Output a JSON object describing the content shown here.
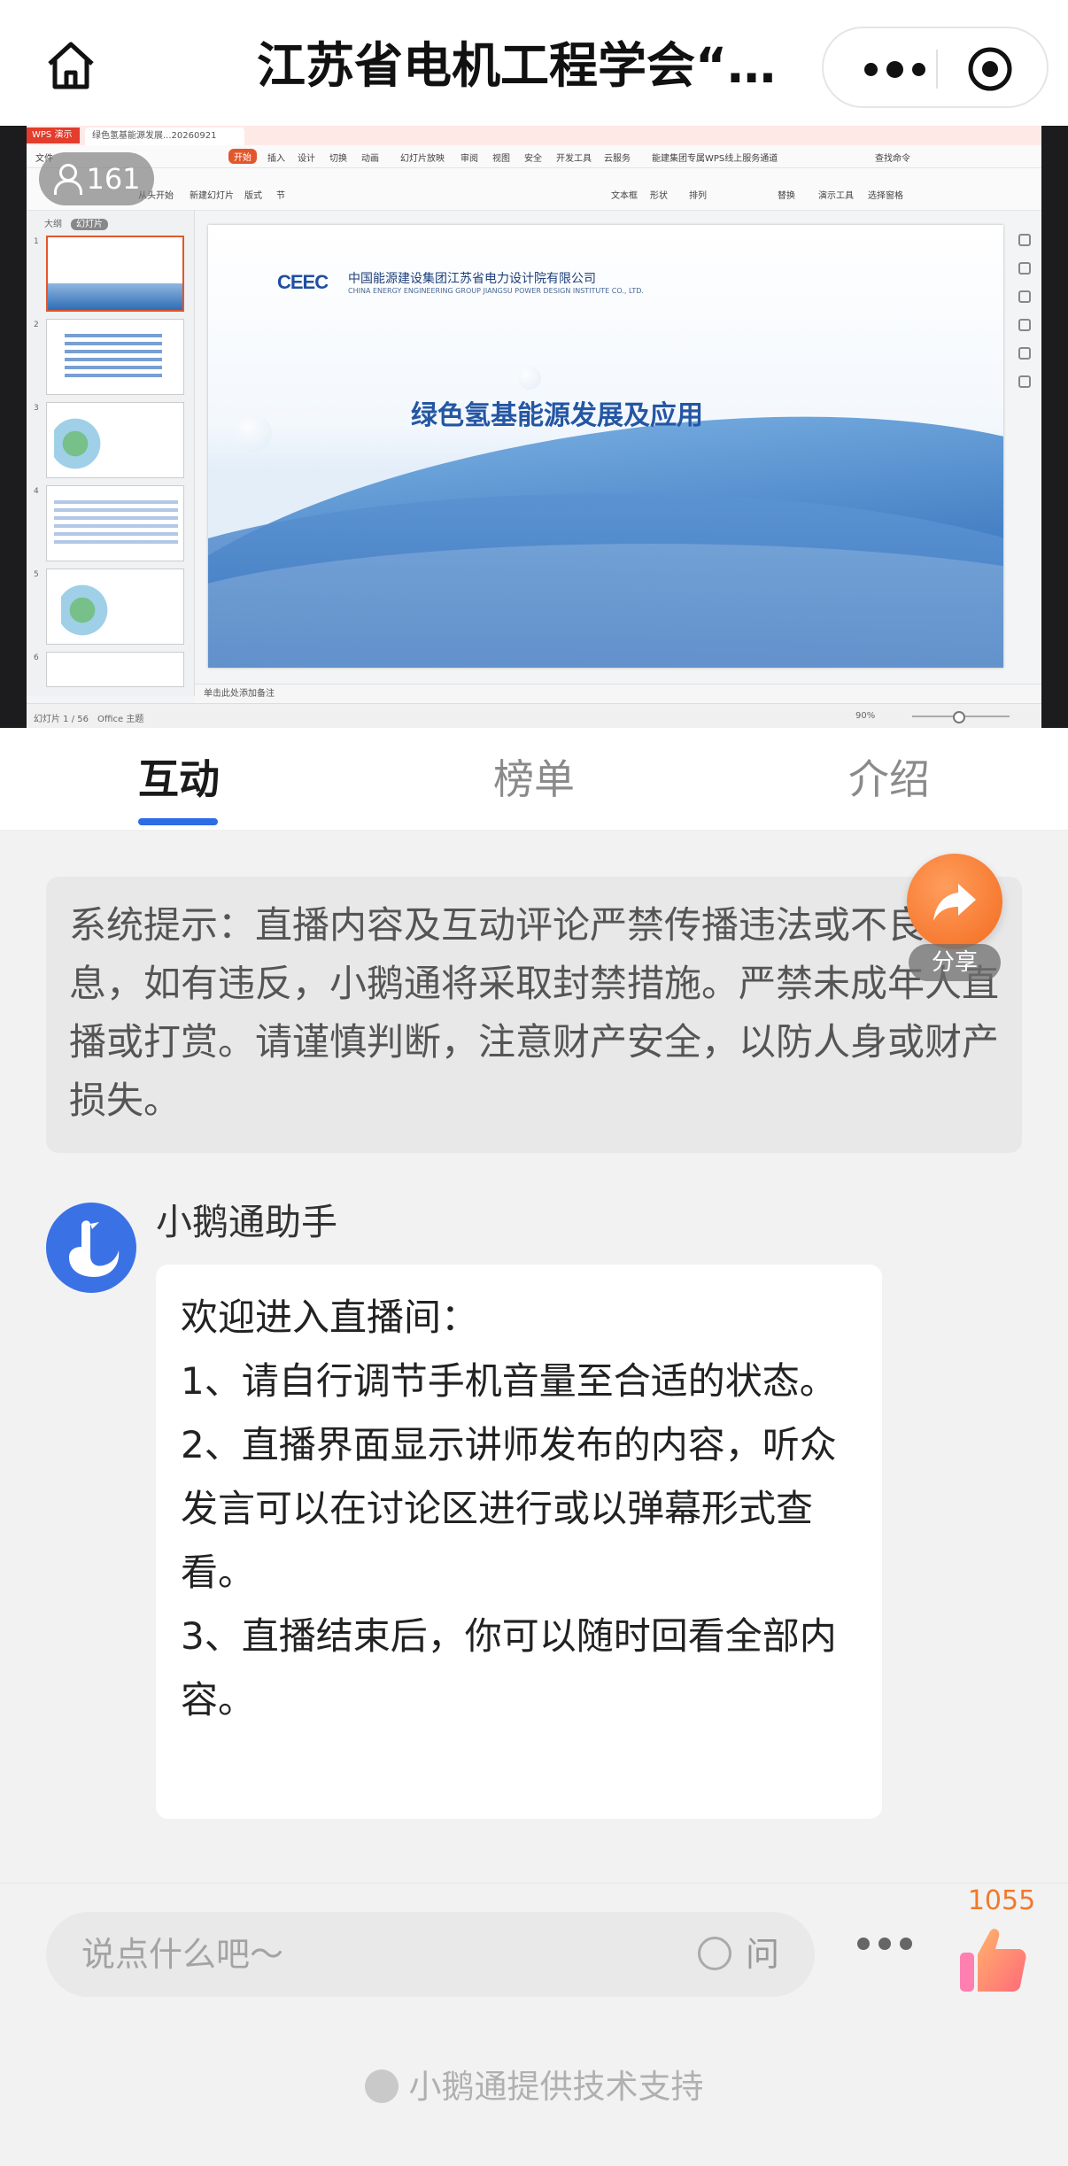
{
  "nav": {
    "title": "江苏省电机工程学会“…"
  },
  "stream": {
    "viewer_count": "161",
    "app_tab1": "WPS 演示",
    "app_tab2": "绿色氢基能源发展...20260921",
    "menu": [
      "文件",
      "开始",
      "插入",
      "设计",
      "切换",
      "动画",
      "幻灯片放映",
      "审阅",
      "视图",
      "安全",
      "开发工具",
      "云服务",
      "能建集团专属WPS线上服务通道"
    ],
    "search_cmd": "查找命令",
    "toolbar": [
      "从头开始",
      "新建幻灯片",
      "版式",
      "节",
      "文本框",
      "形状",
      "排列",
      "替换",
      "演示工具",
      "选择窗格"
    ],
    "sidebar_outline": "大纲",
    "sidebar_slides": "幻灯片",
    "slide": {
      "logo": "CEEC",
      "org_cn": "中国能源建设集团江苏省电力设计院有限公司",
      "org_en": "CHINA ENERGY ENGINEERING GROUP JIANGSU POWER DESIGN INSTITUTE CO., LTD.",
      "title": "绿色氢基能源发展及应用"
    },
    "notes_placeholder": "单击此处添加备注",
    "status_left": "幻灯片 1 / 56",
    "status_theme": "Office 主题",
    "zoom": "90%"
  },
  "tabs": [
    {
      "label": "互动",
      "active": true
    },
    {
      "label": "榜单",
      "active": false
    },
    {
      "label": "介绍",
      "active": false
    }
  ],
  "notice": {
    "text": "系统提示：直播内容及互动评论严禁传播违法或不良信息，如有违反，小鹅通将采取封禁措施。严禁未成年人直播或打赏。请谨慎判断，注意财产安全，以防人身或财产损失。"
  },
  "share": {
    "label": "分享"
  },
  "message": {
    "sender": "小鹅通助手",
    "lines": [
      "欢迎进入直播间：",
      "1、请自行调节手机音量至合适的状态。",
      "2、直播界面显示讲师发布的内容，听众发言可以在讨论区进行或以弹幕形式查看。",
      "3、直播结束后，你可以随时回看全部内容。"
    ]
  },
  "input": {
    "placeholder": "说点什么吧～",
    "ask_label": "问"
  },
  "likes": {
    "count": "1055"
  },
  "footer": {
    "powered_by": "小鹅通提供技术支持"
  },
  "colors": {
    "accent": "#2e6be6",
    "share_orange": "#f36b1f",
    "like_count": "#f07a2b"
  }
}
